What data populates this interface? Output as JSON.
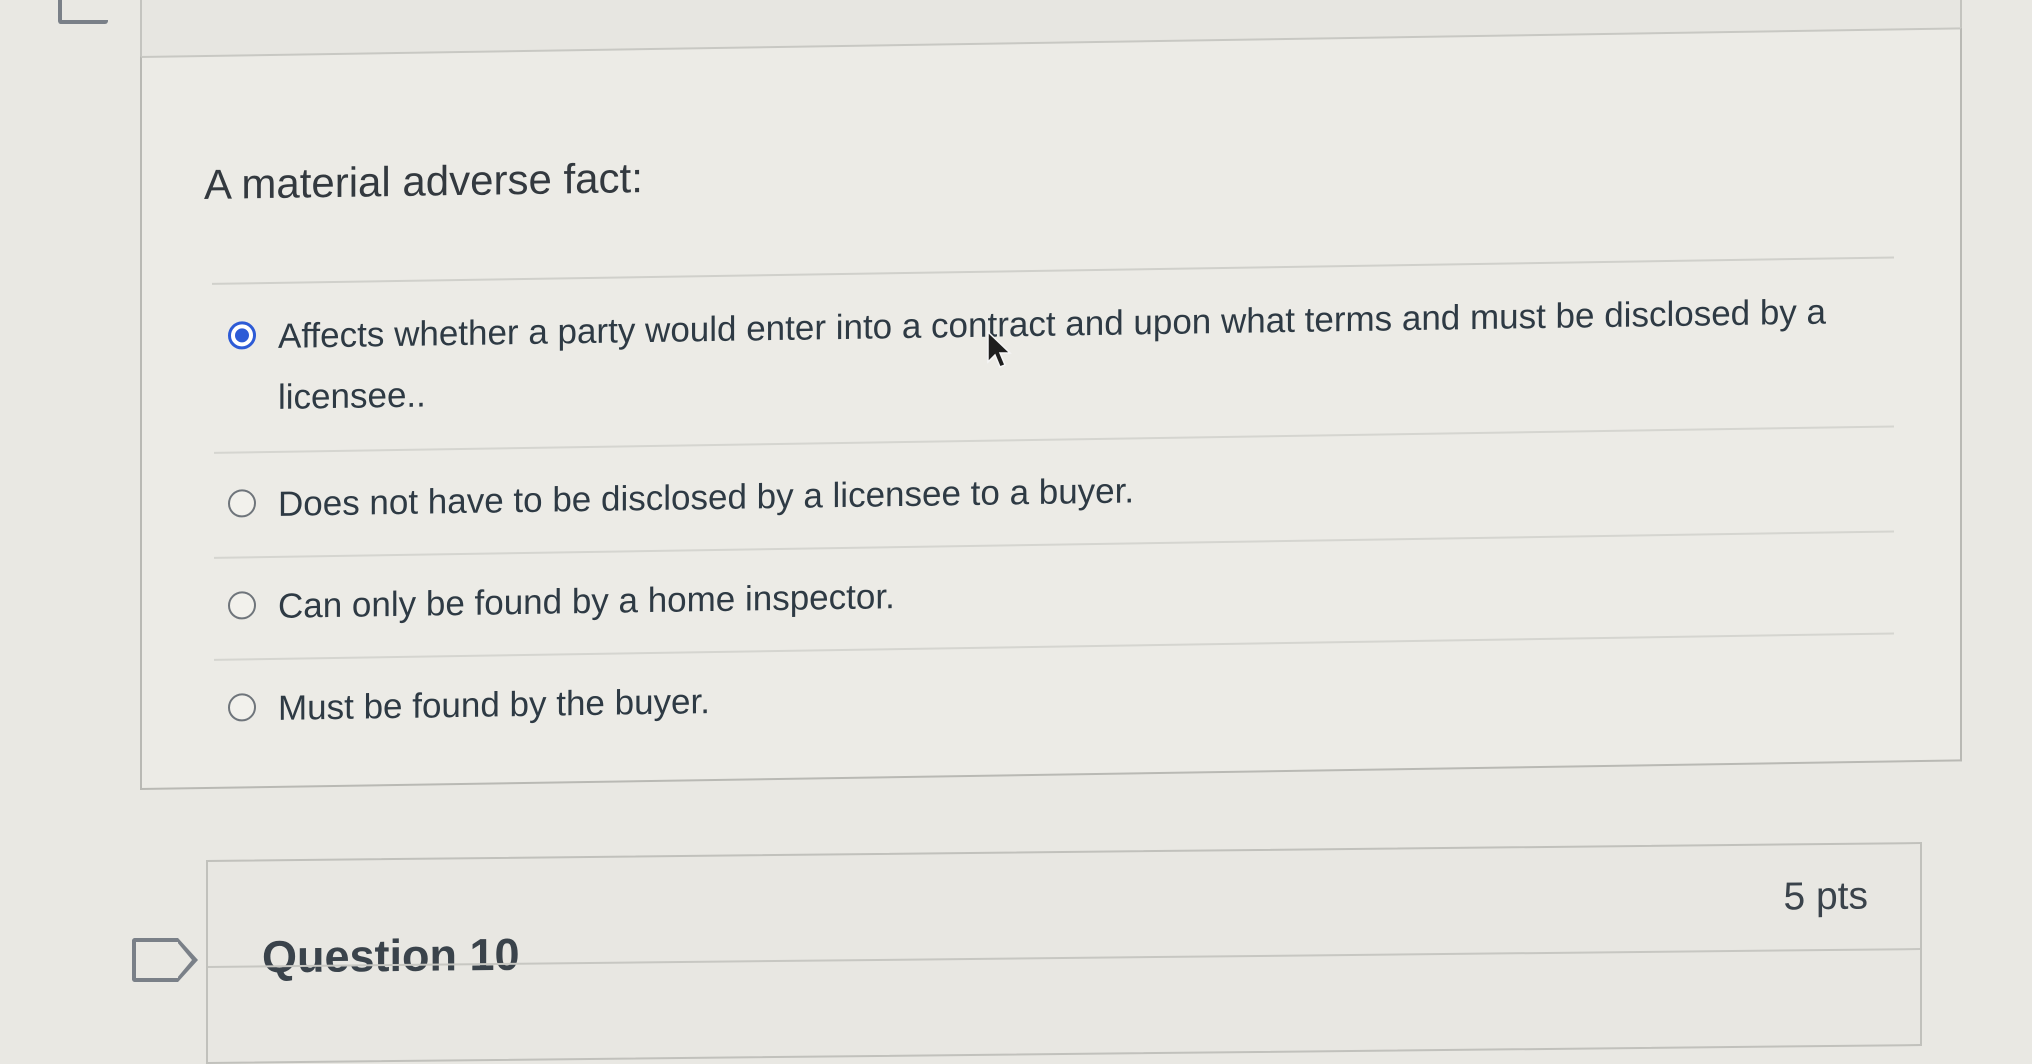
{
  "question": {
    "prompt": "A material adverse fact:",
    "answers": [
      {
        "label": "Affects whether a party would enter into a contract and upon what terms and must be disclosed by a licensee..",
        "selected": true
      },
      {
        "label": "Does not have to be disclosed by a licensee to a buyer.",
        "selected": false
      },
      {
        "label": "Can only be found by a home inspector.",
        "selected": false
      },
      {
        "label": "Must be found by the buyer.",
        "selected": false
      }
    ]
  },
  "next_question": {
    "title": "Question 10",
    "points": "5 pts"
  },
  "colors": {
    "accent": "#2d5bd6",
    "background": "#e9e8e3"
  }
}
